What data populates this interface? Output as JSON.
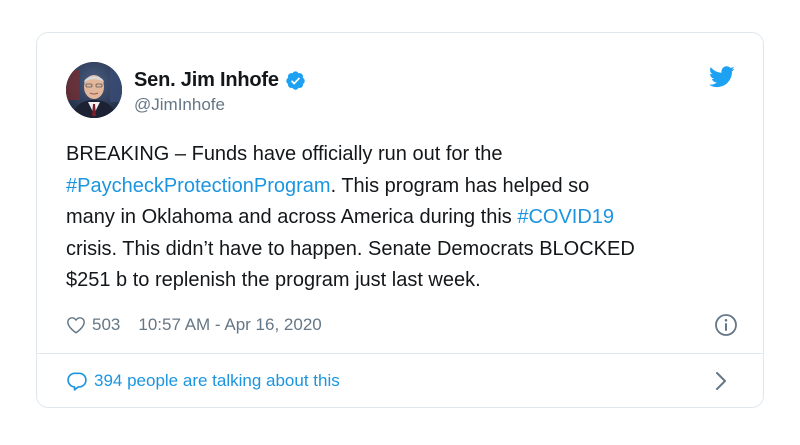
{
  "author": {
    "display_name": "Sen. Jim Inhofe",
    "handle": "@JimInhofe"
  },
  "tweet": {
    "lines": [
      [
        {
          "text": "BREAKING – Funds have officially run out for the",
          "hashtag": false
        }
      ],
      [
        {
          "text": "#PaycheckProtectionProgram",
          "hashtag": true
        },
        {
          "text": ". This program has helped so",
          "hashtag": false
        }
      ],
      [
        {
          "text": "many in Oklahoma and across America during this ",
          "hashtag": false
        },
        {
          "text": "#COVID19",
          "hashtag": true
        }
      ],
      [
        {
          "text": "crisis. This didn’t have to happen. Senate Democrats BLOCKED",
          "hashtag": false
        }
      ],
      [
        {
          "text": "$251 b to replenish the program just last week.",
          "hashtag": false
        }
      ]
    ]
  },
  "meta": {
    "likes": "503",
    "timestamp": "10:57 AM - Apr 16, 2020"
  },
  "footer": {
    "conversation_label": "394 people are talking about this"
  },
  "colors": {
    "link": "#1b95e0",
    "text": "#14171a",
    "muted": "#657786",
    "border": "#e1e8ed"
  },
  "icons": [
    "twitter-bird-icon",
    "verified-badge-icon",
    "heart-icon",
    "info-icon",
    "speech-bubble-icon",
    "chevron-right-icon"
  ]
}
